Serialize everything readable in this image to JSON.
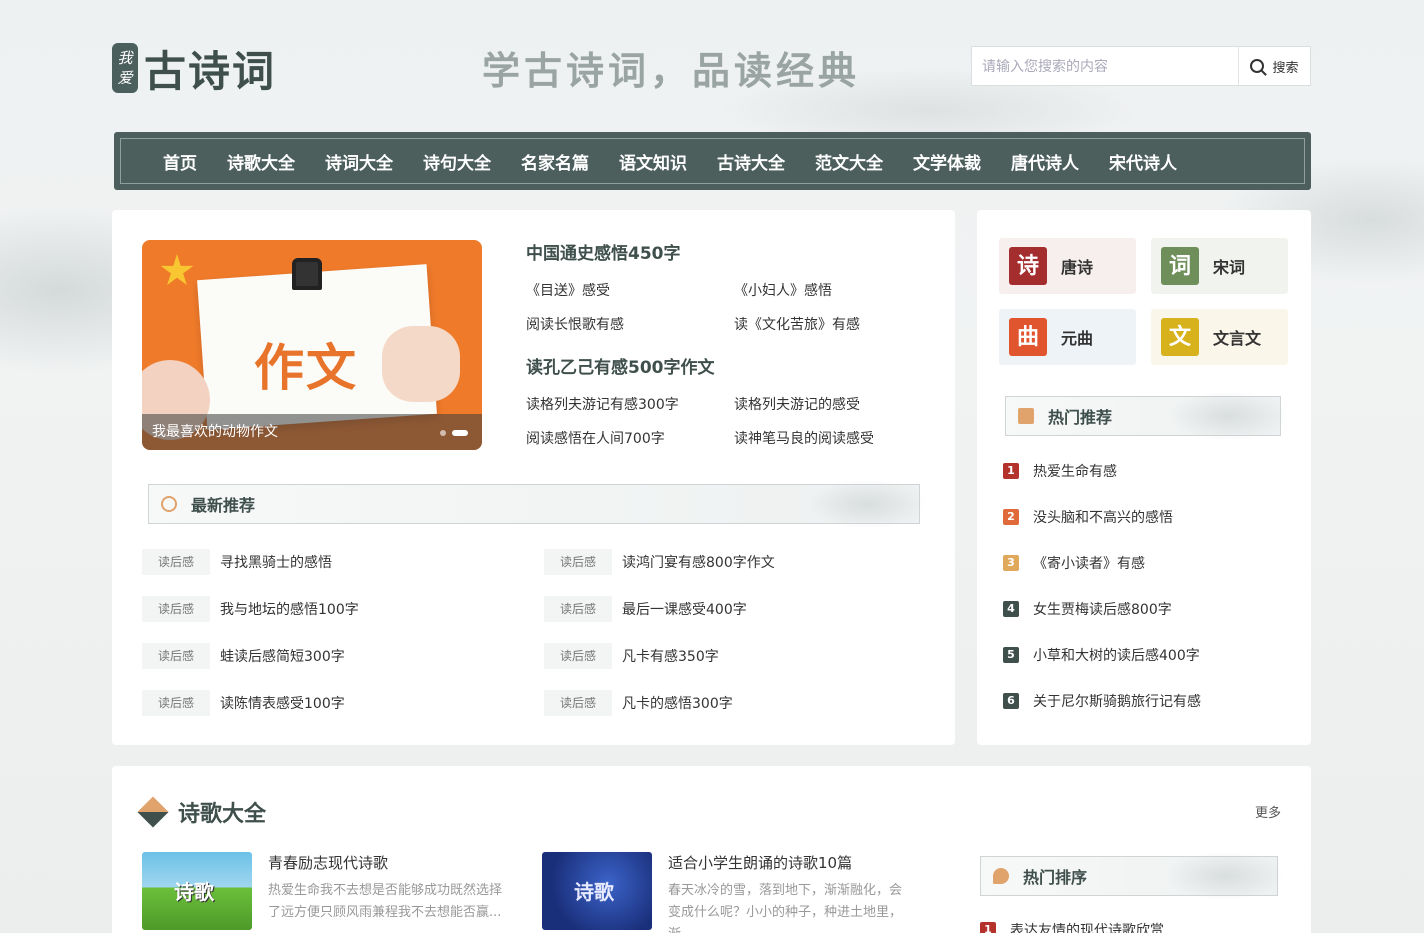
{
  "header": {
    "logo_seal_top": "我",
    "logo_seal_bottom": "爱",
    "logo_text": "古诗词",
    "slogan": "学古诗词，品读经典",
    "search_placeholder": "请输入您搜索的内容",
    "search_button": "搜索"
  },
  "nav": [
    "首页",
    "诗歌大全",
    "诗词大全",
    "诗句大全",
    "名家名篇",
    "语文知识",
    "古诗大全",
    "范文大全",
    "文学体裁",
    "唐代诗人",
    "宋代诗人"
  ],
  "banner": {
    "paper_text": "作文",
    "caption": "我最喜欢的动物作文",
    "slide_count": 2,
    "active_slide": 2
  },
  "topics": [
    {
      "title": "中国通史感悟450字",
      "links": [
        "《目送》感受",
        "《小妇人》感悟",
        "阅读长恨歌有感",
        "读《文化苦旅》有感"
      ]
    },
    {
      "title": "读孔乙己有感500字作文",
      "links": [
        "读格列夫游记有感300字",
        "读格列夫游记的感受",
        "阅读感悟在人间700字",
        "读神笔马良的阅读感受"
      ]
    }
  ],
  "latest": {
    "heading": "最新推荐",
    "items": [
      {
        "tag": "读后感",
        "title": "寻找黑骑士的感悟"
      },
      {
        "tag": "读后感",
        "title": "读鸿门宴有感800字作文"
      },
      {
        "tag": "读后感",
        "title": "我与地坛的感悟100字"
      },
      {
        "tag": "读后感",
        "title": "最后一课感受400字"
      },
      {
        "tag": "读后感",
        "title": "蛙读后感简短300字"
      },
      {
        "tag": "读后感",
        "title": "凡卡有感350字"
      },
      {
        "tag": "读后感",
        "title": "读陈情表感受100字"
      },
      {
        "tag": "读后感",
        "title": "凡卡的感悟300字"
      }
    ]
  },
  "categories": [
    {
      "icon_char": "诗",
      "label": "唐诗",
      "icon_color": "#a42d2d",
      "bg": "#f7efee"
    },
    {
      "icon_char": "词",
      "label": "宋词",
      "icon_color": "#6f8f5a",
      "bg": "#f1f4ee"
    },
    {
      "icon_char": "曲",
      "label": "元曲",
      "icon_color": "#e0542e",
      "bg": "#eef3f7"
    },
    {
      "icon_char": "文",
      "label": "文言文",
      "icon_color": "#d8b21c",
      "bg": "#faf7ea"
    }
  ],
  "hot": {
    "heading": "热门推荐",
    "items": [
      {
        "num": "1",
        "title": "热爱生命有感",
        "color": "#b3322c"
      },
      {
        "num": "2",
        "title": "没头脑和不高兴的感悟",
        "color": "#e06a3a"
      },
      {
        "num": "3",
        "title": "《寄小读者》有感",
        "color": "#e0a85a"
      },
      {
        "num": "4",
        "title": "女生贾梅读后感800字",
        "color": "#3e4f4c"
      },
      {
        "num": "5",
        "title": "小草和大树的读后感400字",
        "color": "#3e4f4c"
      },
      {
        "num": "6",
        "title": "关于尼尔斯骑鹅旅行记有感",
        "color": "#3e4f4c"
      }
    ]
  },
  "poems": {
    "heading": "诗歌大全",
    "more": "更多",
    "items": [
      {
        "title": "青春励志现代诗歌",
        "desc": "热爱生命我不去想是否能够成功既然选择了远方便只顾风雨兼程我不去想能否赢...",
        "thumb_text": "诗歌"
      },
      {
        "title": "适合小学生朗诵的诗歌10篇",
        "desc": "春天冰冷的雪，落到地下，渐渐融化，会变成什么呢？小小的种子，种进土地里，渐...",
        "thumb_text": "诗歌"
      }
    ],
    "rank_heading": "热门排序",
    "rank_first": {
      "num": "1",
      "title": "表达友情的现代诗歌欣赏"
    }
  }
}
